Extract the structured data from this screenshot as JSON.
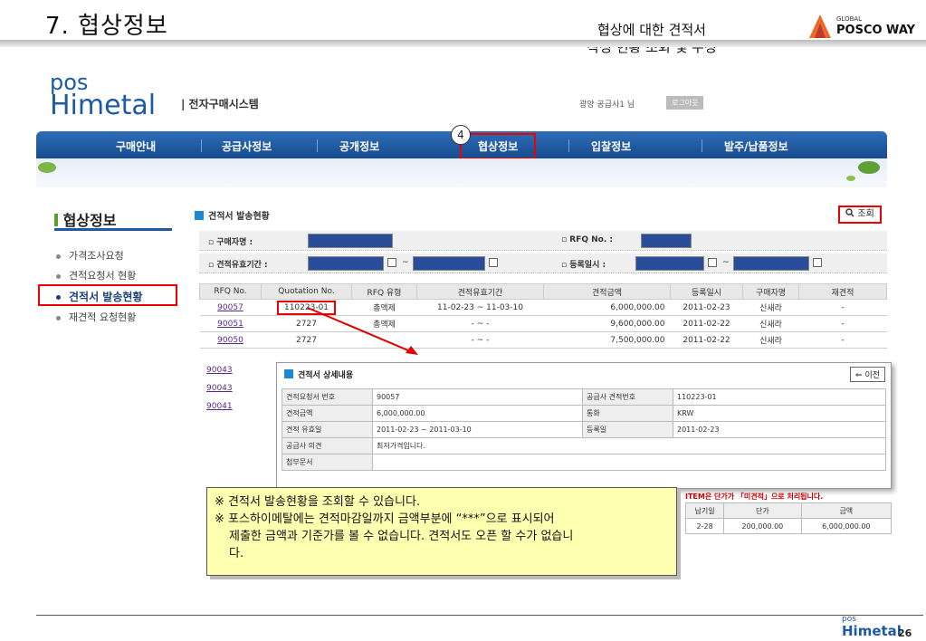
{
  "slide": {
    "title": "7. 협상정보",
    "subtitle_line1": "협상에 대한 견적서",
    "subtitle_line2": "작성 현황 조회 및 수정",
    "global_label": "GLOBAL",
    "brand": "POSCO WAY",
    "page_number": "26",
    "step_badge": "4"
  },
  "app": {
    "logo_top": "pos",
    "logo_bottom": "Himetal",
    "system_name": "| 전자구매시스템",
    "user_info": "광양 공급사1 님",
    "logout_label": "로그아웃"
  },
  "nav": {
    "items": [
      "구매안내",
      "공급사정보",
      "공개정보",
      "협상정보",
      "입찰정보",
      "발주/납품정보"
    ],
    "active": "협상정보"
  },
  "sidebar": {
    "title": "협상정보",
    "items": [
      "가격조사요청",
      "견적요청서 현황",
      "견적서 발송현황",
      "재견적 요청현황"
    ],
    "active": "견적서 발송현황"
  },
  "main": {
    "section_title": "견적서 발송현황",
    "search_label": "조회",
    "filters": {
      "buyer": "구매자명",
      "rfq_no": "RFQ No.",
      "validity": "견적유효기간",
      "reg_date": "등록일시"
    },
    "columns": [
      "RFQ No.",
      "Quotation No.",
      "RFQ 유형",
      "견적유효기간",
      "견적금액",
      "등록일시",
      "구매자명",
      "재견적"
    ],
    "rows": [
      [
        "90057",
        "110223-01",
        "총액제",
        "11-02-23 ~ 11-03-10",
        "6,000,000.00",
        "2011-02-23",
        "신새라",
        "-"
      ],
      [
        "90051",
        "2727",
        "총액제",
        "- ~ -",
        "9,600,000.00",
        "2011-02-22",
        "신새라",
        "-"
      ],
      [
        "90050",
        "2727",
        "-",
        "- ~ -",
        "7,500,000.00",
        "2011-02-22",
        "신새라",
        "-"
      ]
    ],
    "extra_rfq": [
      "90043",
      "90043",
      "90041"
    ]
  },
  "detail": {
    "title": "견적서 상세내용",
    "prev_label": "이전",
    "rows": {
      "req_no_label": "견적요청서 번호",
      "req_no": "90057",
      "sup_no_label": "공급사 견적번호",
      "sup_no": "110223-01",
      "amount_label": "견적금액",
      "amount": "6,000,000.00",
      "currency_label": "통화",
      "currency": "KRW",
      "valid_label": "견적 유효일",
      "valid": "2011-02-23 ~ 2011-03-10",
      "reg_label": "등록일",
      "reg": "2011-02-23",
      "opinion_label": "공급사 의견",
      "opinion": "최저가격입니다.",
      "attach_label": "첨부문서"
    },
    "red_note": "ITEM은 단가가 「미견적」으로 처리됩니다.",
    "mini_headers": [
      "납기일",
      "단가",
      "금액"
    ],
    "mini_row": [
      "2-28",
      "200,000.00",
      "6,000,000.00"
    ]
  },
  "note": {
    "line1": "※ 견적서 발송현황을 조회할 수 있습니다.",
    "line2": "※ 포스하이메탈에는 견적마감일까지 금액부분에 “***”으로 표시되어",
    "line3": "제출한 금액과 기준가를 볼 수 없습니다. 견적서도 오픈 할 수가 없습니",
    "line4": "다."
  }
}
